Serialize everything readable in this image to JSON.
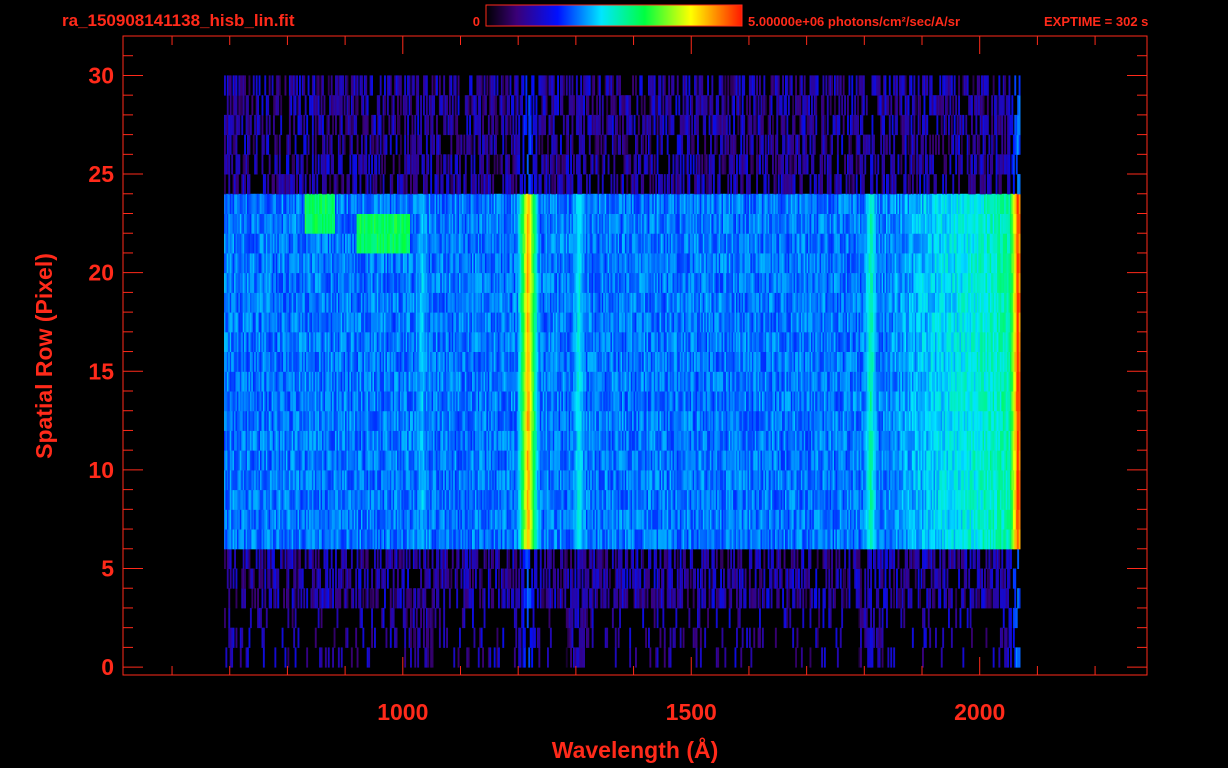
{
  "chart_data": {
    "type": "heatmap",
    "title": "ra_150908141138_hisb_lin.fit",
    "colorbar": {
      "min_label": "0",
      "max_label": "5.00000e+06 photons/cm²/sec/A/sr",
      "min": 0,
      "max": 5000000,
      "colormap": "rainbow"
    },
    "exposure_label": "EXPTIME = 302 s",
    "xlabel": "Wavelength (Å)",
    "ylabel": "Spatial Row (Pixel)",
    "xlim": [
      515,
      2290
    ],
    "ylim": [
      -0.4,
      32
    ],
    "xticks": [
      1000,
      1500,
      2000
    ],
    "yticks": [
      0,
      5,
      10,
      15,
      20,
      25,
      30
    ],
    "xtick_labels": [
      "1000",
      "1500",
      "2000"
    ],
    "ytick_labels": [
      "0",
      "5",
      "10",
      "15",
      "20",
      "25",
      "30"
    ],
    "x_minor_step": 100,
    "y_minor_step": 1,
    "data_extent": {
      "x_min": 690,
      "x_max": 2070,
      "y_min": 0,
      "y_max": 30
    },
    "bright_slit_rows": [
      6,
      24
    ],
    "emission_lines": [
      {
        "wavelength": 1216,
        "relative_intensity": 0.85
      },
      {
        "wavelength": 1304,
        "relative_intensity": 0.45
      },
      {
        "wavelength": 1032,
        "relative_intensity": 0.4
      },
      {
        "wavelength": 1810,
        "relative_intensity": 0.5
      },
      {
        "wavelength": 2065,
        "relative_intensity": 0.95
      }
    ],
    "feature_regions": [
      {
        "x_range": [
          830,
          880
        ],
        "y_range": [
          22,
          24
        ],
        "relative_intensity": 0.55
      },
      {
        "x_range": [
          920,
          1010
        ],
        "y_range": [
          21,
          23
        ],
        "relative_intensity": 0.55
      }
    ]
  },
  "colors": {
    "background": "#000000",
    "axis": "#ff2a1a",
    "text": "#ff2a1a"
  }
}
